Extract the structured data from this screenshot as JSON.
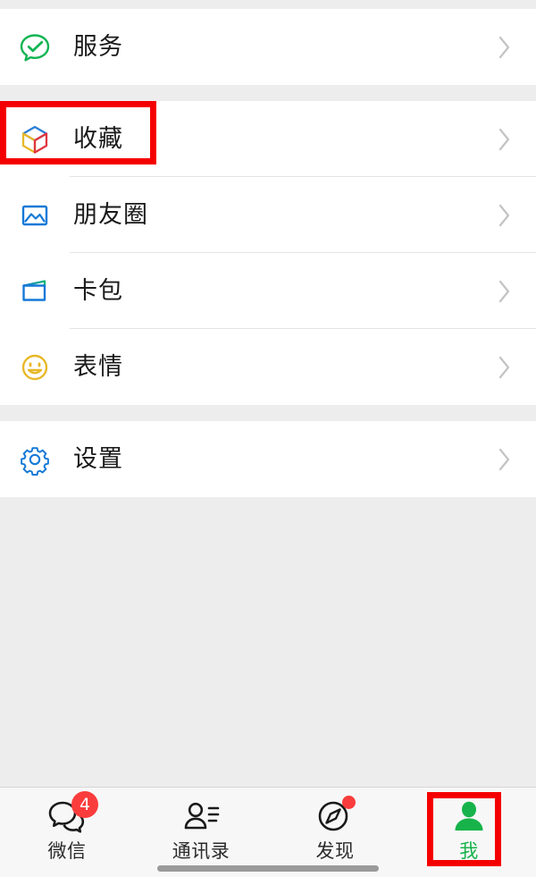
{
  "screen": {
    "app": "WeChat",
    "page_title": "我",
    "background_color": "#ededed",
    "accent_color": "#17b34a",
    "annotation_color": "#f50000"
  },
  "menu": {
    "groups": [
      {
        "items": [
          {
            "label": "服务",
            "icon": "services-bubble-check-icon",
            "icon_color": "#12b452",
            "chevron": "›"
          }
        ]
      },
      {
        "items": [
          {
            "label": "收藏",
            "icon": "favorites-cube-icon",
            "icon_color": "#2a7fd4",
            "chevron": "›",
            "highlighted": true
          },
          {
            "label": "朋友圈",
            "icon": "moments-photo-icon",
            "icon_color": "#1479d7",
            "chevron": "›"
          },
          {
            "label": "卡包",
            "icon": "cards-wallet-icon",
            "icon_color": "#1479d7",
            "chevron": "›"
          },
          {
            "label": "表情",
            "icon": "stickers-smiley-icon",
            "icon_color": "#e8b829",
            "chevron": "›"
          }
        ]
      },
      {
        "items": [
          {
            "label": "设置",
            "icon": "settings-gear-icon",
            "icon_color": "#1479d7",
            "chevron": "›"
          }
        ]
      }
    ]
  },
  "tabbar": {
    "tabs": [
      {
        "label": "微信",
        "icon": "chat-bubble-icon",
        "badge": "4",
        "badge_type": "count",
        "active": false
      },
      {
        "label": "通讯录",
        "icon": "contacts-person-icon",
        "badge": "",
        "badge_type": "none",
        "active": false
      },
      {
        "label": "发现",
        "icon": "discover-compass-icon",
        "badge": "",
        "badge_type": "dot",
        "active": false
      },
      {
        "label": "我",
        "icon": "me-person-icon",
        "badge": "",
        "badge_type": "none",
        "active": true
      }
    ]
  },
  "annotations": [
    {
      "name": "favorites-row-highlight",
      "target": "收藏"
    },
    {
      "name": "me-tab-highlight",
      "target": "我"
    }
  ]
}
